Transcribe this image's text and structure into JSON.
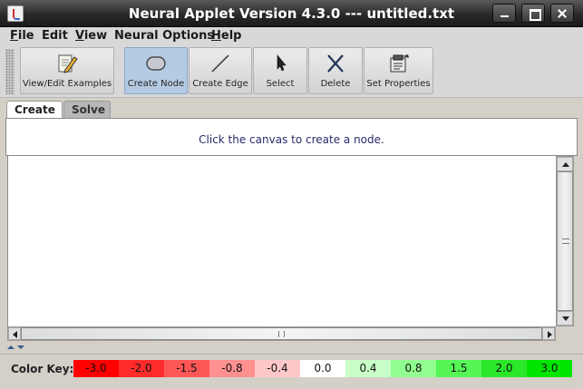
{
  "window": {
    "title": "Neural Applet Version 4.3.0 --- untitled.txt"
  },
  "menu": [
    {
      "mnemonic": "F",
      "rest": "ile"
    },
    {
      "mnemonic": "",
      "rest": "Edit"
    },
    {
      "mnemonic": "V",
      "rest": "iew"
    },
    {
      "mnemonic": "",
      "rest": "Neural Options"
    },
    {
      "mnemonic": "H",
      "rest": "elp"
    }
  ],
  "toolbar": {
    "view_edit_examples": "View/Edit Examples",
    "create_node": "Create Node",
    "create_edge": "Create Edge",
    "select": "Select",
    "delete": "Delete",
    "set_properties": "Set Properties",
    "active": "create_node"
  },
  "tabs": {
    "create": "Create",
    "solve": "Solve",
    "selected": "create"
  },
  "message": "Click the canvas to create a node.",
  "color_key": {
    "label": "Color Key:",
    "swatches": [
      {
        "value": "-3.0",
        "color": "#ff0000"
      },
      {
        "value": "-2.0",
        "color": "#ff2b2b"
      },
      {
        "value": "-1.5",
        "color": "#ff5656"
      },
      {
        "value": "-0.8",
        "color": "#ff9090"
      },
      {
        "value": "-0.4",
        "color": "#ffc8c8"
      },
      {
        "value": "0.0",
        "color": "#ffffff"
      },
      {
        "value": "0.4",
        "color": "#c8ffc8"
      },
      {
        "value": "0.8",
        "color": "#90ff90"
      },
      {
        "value": "1.5",
        "color": "#56f556"
      },
      {
        "value": "2.0",
        "color": "#2be82b"
      },
      {
        "value": "3.0",
        "color": "#00e600"
      }
    ]
  }
}
